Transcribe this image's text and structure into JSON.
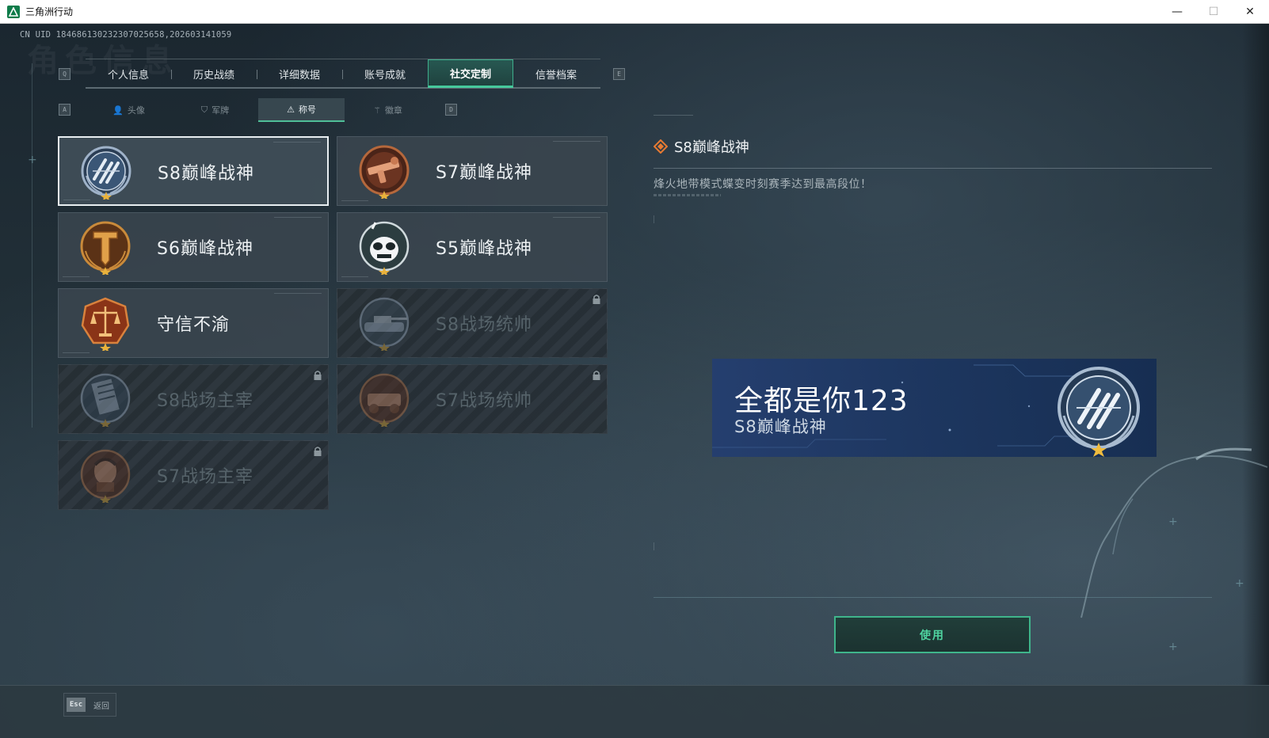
{
  "window": {
    "title": "三角洲行动",
    "minimize": "—",
    "maximize": "☐",
    "close": "✕"
  },
  "uid_text": "CN UID 18468613023230702565​8,202603141059",
  "ghost_heading": "角色信息",
  "main_tabs": {
    "key_left": "Q",
    "key_right": "E",
    "items": [
      {
        "label": "个人信息",
        "active": false
      },
      {
        "label": "历史战绩",
        "active": false
      },
      {
        "label": "详细数据",
        "active": false
      },
      {
        "label": "账号成就",
        "active": false
      },
      {
        "label": "社交定制",
        "active": true
      },
      {
        "label": "信誉档案",
        "active": false
      }
    ]
  },
  "sub_tabs": {
    "key_left": "A",
    "key_right": "D",
    "items": [
      {
        "label": "头像",
        "icon": "person-icon",
        "active": false
      },
      {
        "label": "军牌",
        "icon": "dogtag-icon",
        "active": false
      },
      {
        "label": "称号",
        "icon": "title-icon",
        "active": true
      },
      {
        "label": "徽章",
        "icon": "emblem-icon",
        "active": false
      }
    ]
  },
  "titles": [
    {
      "name": "S8巅峰战神",
      "badge": "s8-peak-badge-icon",
      "locked": false,
      "selected": true
    },
    {
      "name": "S7巅峰战神",
      "badge": "s7-peak-badge-icon",
      "locked": false,
      "selected": false
    },
    {
      "name": "S6巅峰战神",
      "badge": "s6-peak-badge-icon",
      "locked": false,
      "selected": false
    },
    {
      "name": "S5巅峰战神",
      "badge": "s5-peak-badge-icon",
      "locked": false,
      "selected": false
    },
    {
      "name": "守信不渝",
      "badge": "scales-badge-icon",
      "locked": false,
      "selected": false
    },
    {
      "name": "S8战场统帅",
      "badge": "tank-badge-icon",
      "locked": true,
      "selected": false
    },
    {
      "name": "S8战场主宰",
      "badge": "building-badge-icon",
      "locked": true,
      "selected": false
    },
    {
      "name": "S7战场统帅",
      "badge": "vehicle-badge-icon",
      "locked": true,
      "selected": false
    },
    {
      "name": "S7战场主宰",
      "badge": "soldier-badge-icon",
      "locked": true,
      "selected": false
    }
  ],
  "detail": {
    "title": "S8巅峰战神",
    "description": "烽火地带模式蝶变时刻赛季达到最高段位！"
  },
  "preview": {
    "player_name": "全都是你123",
    "title": "S8巅峰战神"
  },
  "use_button": "使用",
  "footer": {
    "esc_key": "Esc",
    "esc_label": "返回"
  },
  "colors": {
    "accent_green": "#46c99c",
    "badge_silver": "#9fb2c8",
    "badge_bronze": "#b5683c",
    "badge_gold": "#c98a3a",
    "diamond_orange": "#e77a32",
    "preview_blue": "#1f3c74"
  }
}
